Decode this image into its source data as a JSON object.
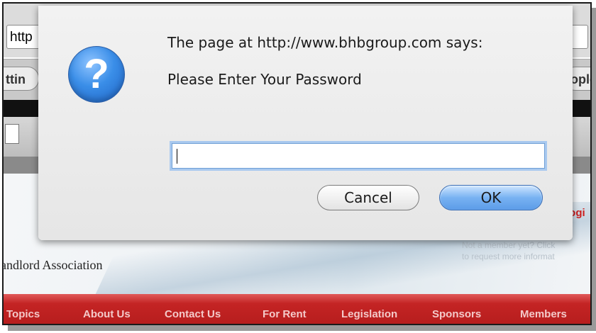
{
  "browser": {
    "url_text": "http",
    "bookmark_left": "ttin",
    "bookmark_right": "ople"
  },
  "page": {
    "org_name": "andlord Association",
    "login_link": "Logi",
    "not_member_line1": "Not a member yet? Click",
    "not_member_line2": "to request more informat",
    "nav": [
      "Topics",
      "About Us",
      "Contact Us",
      "For Rent",
      "Legislation",
      "Sponsors",
      "Members"
    ]
  },
  "dialog": {
    "icon": "question-icon",
    "icon_glyph": "?",
    "title": "The page at http://www.bhbgroup.com says:",
    "message": "Please Enter Your Password",
    "input_value": "",
    "cancel_label": "Cancel",
    "ok_label": "OK",
    "accent_color": "#5c9ce8"
  }
}
